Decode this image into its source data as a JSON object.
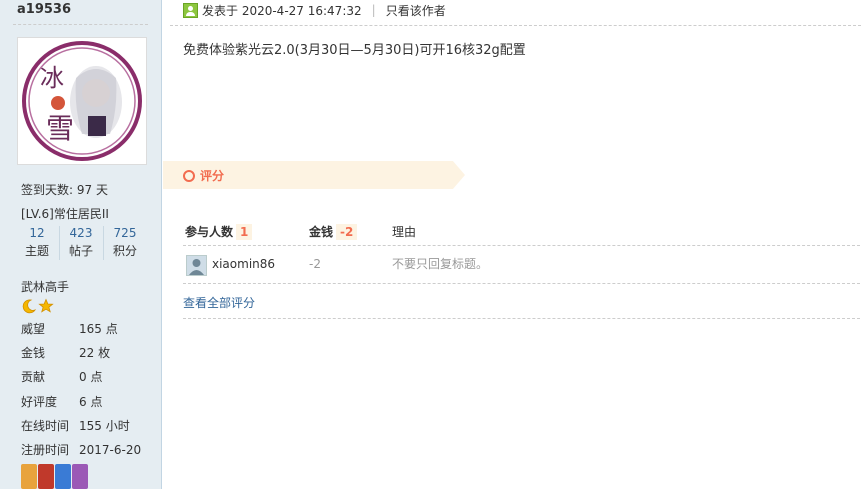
{
  "user": {
    "name": "a19536",
    "avatar_text": "冰雪",
    "signin": "签到天数: 97 天",
    "level": "[LV.6]常住居民II",
    "counts": [
      {
        "num": "12",
        "label": "主题"
      },
      {
        "num": "423",
        "label": "帖子"
      },
      {
        "num": "725",
        "label": "积分"
      }
    ],
    "rank": "武林高手",
    "info": [
      {
        "k": "威望",
        "v": "165 点"
      },
      {
        "k": "金钱",
        "v": "22 枚"
      },
      {
        "k": "贡献",
        "v": "0 点"
      },
      {
        "k": "好评度",
        "v": "6 点"
      },
      {
        "k": "在线时间",
        "v": "155 小时"
      },
      {
        "k": "注册时间",
        "v": "2017-6-20"
      }
    ],
    "medal_colors": [
      "#e8a33d",
      "#c0392b",
      "#3a7bd5",
      "#9b59b6"
    ]
  },
  "post": {
    "posted_at": "发表于 2020-4-27 16:47:32",
    "only_author": "只看该作者",
    "body": "免费体验紫光云2.0(3月30日—5月30日)可开16核32g配置"
  },
  "rating": {
    "label": "评分",
    "col_participants": "参与人数",
    "participants": "1",
    "col_money": "金钱",
    "money_total": "-2",
    "col_reason": "理由",
    "rows": [
      {
        "user": "xiaomin86",
        "money": "-2",
        "reason": "不要只回复标题。"
      }
    ],
    "view_all": "查看全部评分"
  },
  "colors": {
    "accent": "#f26c4f",
    "link": "#336699",
    "sidebar_bg": "#e5edf2",
    "rate_bg": "#fdf3e2"
  },
  "icons": [
    "online-icon",
    "moon-icon",
    "star-icon",
    "rating-ring-icon"
  ]
}
